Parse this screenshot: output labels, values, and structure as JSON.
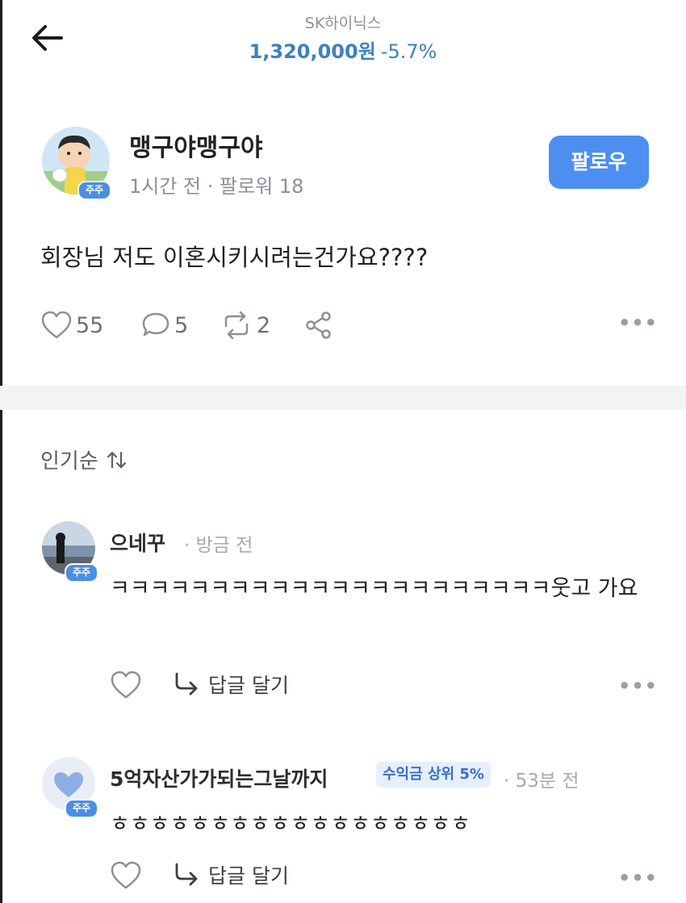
{
  "header": {
    "stock_name": "SK하이닉스",
    "price": "1,320,000원",
    "change": "-5.7%"
  },
  "post": {
    "author": "맹구야맹구야",
    "avatar_badge": "주주",
    "meta": "1시간 전 · 팔로워 18",
    "follow_label": "팔로우",
    "body": "회장님 저도 이혼시키시려는건가요????",
    "likes": "55",
    "comments": "5",
    "reposts": "2"
  },
  "sort": {
    "label": "인기순"
  },
  "comments": [
    {
      "name": "으네꾸",
      "time": "· 방금 전",
      "badge": "주주",
      "text": "ㅋㅋㅋㅋㅋㅋㅋㅋㅋㅋㅋㅋㅋㅋㅋㅋㅋㅋㅋㅋㅋㅋ웃고 가요",
      "reply_label": "답글 달기"
    },
    {
      "name": "5억자산가가되는그날까지",
      "rank_badge": "수익금 상위 5%",
      "time": "· 53분 전",
      "badge": "주주",
      "text": "ㅎㅎㅎㅎㅎㅎㅎㅎㅎㅎㅎㅎㅎㅎㅎㅎㅎㅎ",
      "reply_label": "답글 달기"
    }
  ],
  "colors": {
    "accent": "#4c8ff0",
    "price": "#3d7fc1",
    "badge": "#4b8fe3"
  }
}
